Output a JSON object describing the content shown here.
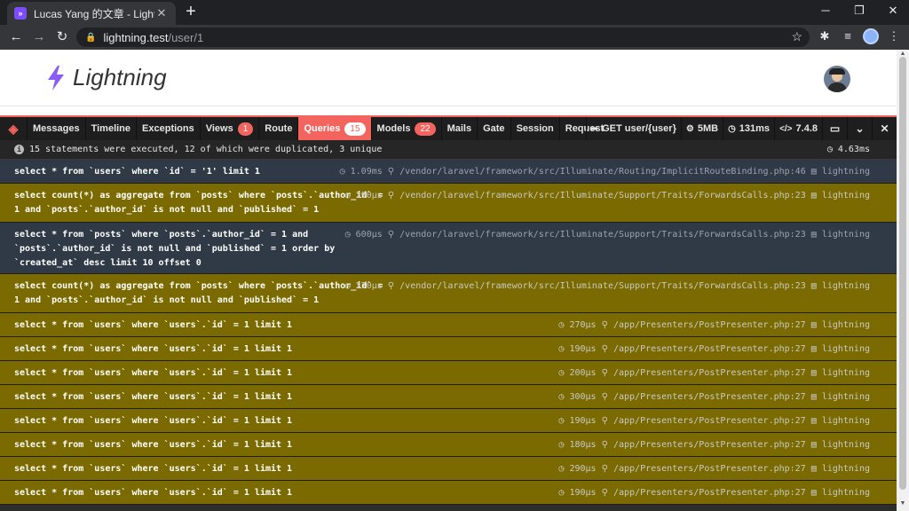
{
  "browser": {
    "tab_title": "Lucas Yang 的文章 - Lightning",
    "tab_favicon": "»",
    "url_host": "lightning.test",
    "url_path": "/user/1"
  },
  "site": {
    "brand_name": "Lightning",
    "brand_color": "#7c4dff"
  },
  "debugbar": {
    "accent_color": "#f4645f",
    "tabs": [
      {
        "label": "Messages",
        "badge": ""
      },
      {
        "label": "Timeline",
        "badge": ""
      },
      {
        "label": "Exceptions",
        "badge": ""
      },
      {
        "label": "Views",
        "badge": "1"
      },
      {
        "label": "Route",
        "badge": ""
      },
      {
        "label": "Queries",
        "badge": "15"
      },
      {
        "label": "Models",
        "badge": "22"
      },
      {
        "label": "Mails",
        "badge": ""
      },
      {
        "label": "Gate",
        "badge": ""
      },
      {
        "label": "Session",
        "badge": ""
      },
      {
        "label": "Request",
        "badge": ""
      }
    ],
    "active_tab": "Queries",
    "route": "GET user/{user}",
    "memory": "5MB",
    "time": "131ms",
    "php_version": "7.4.8",
    "status_text": "15 statements were executed, 12 of which were duplicated, 3 unique",
    "total_time": "4.63ms",
    "queries": [
      {
        "duplicate": false,
        "lines": [
          "select * from `users` where `id` = '1' limit 1"
        ],
        "time": "1.09ms",
        "source": "/vendor/laravel/framework/src/Illuminate/Routing/ImplicitRouteBinding.php:46",
        "connection": "lightning"
      },
      {
        "duplicate": true,
        "lines": [
          "select count(*) as aggregate from `posts` where `posts`.`author_id` =",
          "1 and `posts`.`author_id` is not null and `published` = 1"
        ],
        "time": "290μs",
        "source": "/vendor/laravel/framework/src/Illuminate/Support/Traits/ForwardsCalls.php:23",
        "connection": "lightning"
      },
      {
        "duplicate": false,
        "lines": [
          "select * from `posts` where `posts`.`author_id` = 1 and",
          "`posts`.`author_id` is not null and `published` = 1 order by",
          "`created_at` desc limit 10 offset 0"
        ],
        "time": "600μs",
        "source": "/vendor/laravel/framework/src/Illuminate/Support/Traits/ForwardsCalls.php:23",
        "connection": "lightning"
      },
      {
        "duplicate": true,
        "lines": [
          "select count(*) as aggregate from `posts` where `posts`.`author_id` =",
          "1 and `posts`.`author_id` is not null and `published` = 1"
        ],
        "time": "270μs",
        "source": "/vendor/laravel/framework/src/Illuminate/Support/Traits/ForwardsCalls.php:23",
        "connection": "lightning"
      },
      {
        "duplicate": true,
        "lines": [
          "select * from `users` where `users`.`id` = 1 limit 1"
        ],
        "time": "270μs",
        "source": "/app/Presenters/PostPresenter.php:27",
        "connection": "lightning"
      },
      {
        "duplicate": true,
        "lines": [
          "select * from `users` where `users`.`id` = 1 limit 1"
        ],
        "time": "190μs",
        "source": "/app/Presenters/PostPresenter.php:27",
        "connection": "lightning"
      },
      {
        "duplicate": true,
        "lines": [
          "select * from `users` where `users`.`id` = 1 limit 1"
        ],
        "time": "200μs",
        "source": "/app/Presenters/PostPresenter.php:27",
        "connection": "lightning"
      },
      {
        "duplicate": true,
        "lines": [
          "select * from `users` where `users`.`id` = 1 limit 1"
        ],
        "time": "300μs",
        "source": "/app/Presenters/PostPresenter.php:27",
        "connection": "lightning"
      },
      {
        "duplicate": true,
        "lines": [
          "select * from `users` where `users`.`id` = 1 limit 1"
        ],
        "time": "190μs",
        "source": "/app/Presenters/PostPresenter.php:27",
        "connection": "lightning"
      },
      {
        "duplicate": true,
        "lines": [
          "select * from `users` where `users`.`id` = 1 limit 1"
        ],
        "time": "180μs",
        "source": "/app/Presenters/PostPresenter.php:27",
        "connection": "lightning"
      },
      {
        "duplicate": true,
        "lines": [
          "select * from `users` where `users`.`id` = 1 limit 1"
        ],
        "time": "290μs",
        "source": "/app/Presenters/PostPresenter.php:27",
        "connection": "lightning"
      },
      {
        "duplicate": true,
        "lines": [
          "select * from `users` where `users`.`id` = 1 limit 1"
        ],
        "time": "190μs",
        "source": "/app/Presenters/PostPresenter.php:27",
        "connection": "lightning"
      }
    ]
  }
}
